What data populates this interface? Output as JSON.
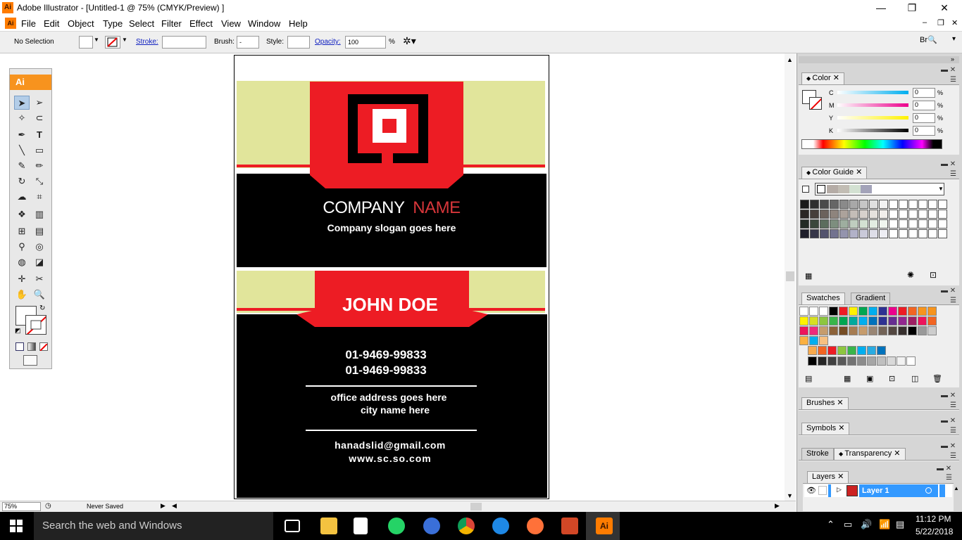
{
  "window": {
    "title": "Adobe Illustrator - [Untitled-1 @ 75% (CMYK/Preview) ]",
    "app_icon": "Ai",
    "minimize": "—",
    "restore": "❐",
    "close": "✕"
  },
  "menu": {
    "items": [
      "File",
      "Edit",
      "Object",
      "Type",
      "Select",
      "Filter",
      "Effect",
      "View",
      "Window",
      "Help"
    ],
    "doc_controls": [
      "–",
      "❐",
      "✕"
    ]
  },
  "control_bar": {
    "selection": "No Selection",
    "stroke_label": "Stroke:",
    "brush_label": "Brush:",
    "brush_value": "-",
    "style_label": "Style:",
    "opacity_label": "Opacity:",
    "opacity_value": "100",
    "percent": "%"
  },
  "toolbox": {
    "header": "Ai"
  },
  "status": {
    "zoom": "75%",
    "info": "Never Saved"
  },
  "card_front": {
    "company_word1": "COMPANY",
    "company_word2": "NAME",
    "slogan": "Company slogan goes here"
  },
  "card_back": {
    "name": "JOHN DOE",
    "phone1": "01-9469-99833",
    "phone2": "01-9469-99833",
    "address1": "office address goes here",
    "address2": "city name here",
    "email": "hanadslid@gmail.com",
    "website": "www.sc.so.com"
  },
  "panels": {
    "color": {
      "tab": "Color",
      "channels": [
        {
          "label": "C",
          "value": "0",
          "unit": "%"
        },
        {
          "label": "M",
          "value": "0",
          "unit": "%"
        },
        {
          "label": "Y",
          "value": "0",
          "unit": "%"
        },
        {
          "label": "K",
          "value": "0",
          "unit": "%"
        }
      ]
    },
    "color_guide": {
      "tab": "Color Guide"
    },
    "swatches": {
      "tab": "Swatches",
      "tab2": "Gradient"
    },
    "brushes": {
      "tab": "Brushes"
    },
    "symbols": {
      "tab": "Symbols"
    },
    "stroke": {
      "tab": "Stroke",
      "tab2": "Transparency"
    },
    "layers": {
      "tab": "Layers",
      "layer_name": "Layer 1"
    }
  },
  "taskbar": {
    "search_placeholder": "Search the web and Windows",
    "time": "11:12 PM",
    "date": "5/22/2018",
    "active_app": "Ai"
  },
  "colors": {
    "brand_red": "#ed1c24",
    "card_yellow": "#e1e59b",
    "ai_orange": "#f7931e",
    "selection_blue": "#3399ff"
  }
}
